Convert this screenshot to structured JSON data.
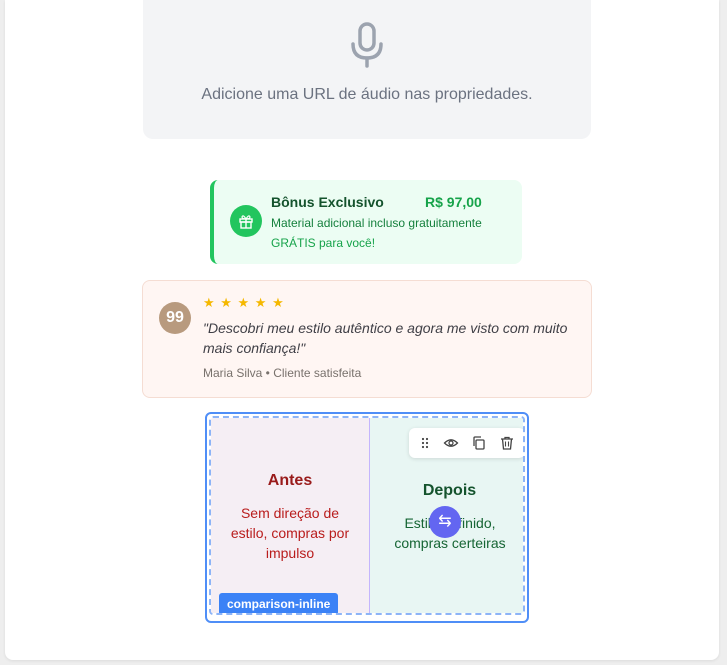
{
  "audio_placeholder": {
    "icon": "microphone-icon",
    "text": "Adicione uma URL de áudio nas propriedades."
  },
  "bonus": {
    "icon": "gift-icon",
    "title": "Bônus Exclusivo",
    "price": "R$ 97,00",
    "description": "Material adicional incluso gratuitamente",
    "free_text": "GRÁTIS para você!",
    "accent_color": "#22c55e"
  },
  "testimonial": {
    "avatar_icon": "quote-icon",
    "avatar_glyph": "99",
    "rating": 5,
    "stars": "★ ★ ★ ★ ★",
    "quote": "\"Descobri meu estilo autêntico e agora me visto com muito mais confiança!\"",
    "author": "Maria Silva • Cliente satisfeita"
  },
  "comparison": {
    "type_label": "comparison-inline",
    "before": {
      "title": "Antes",
      "description": "Sem direção de estilo, compras por impulso"
    },
    "after": {
      "title": "Depois",
      "description": "Estilo definido, compras certeiras"
    },
    "toolbar": [
      "drag-handle-icon",
      "eye-icon",
      "duplicate-icon",
      "trash-icon"
    ],
    "selection_color": "#4f8ef7",
    "handle_color": "#6366f1"
  }
}
